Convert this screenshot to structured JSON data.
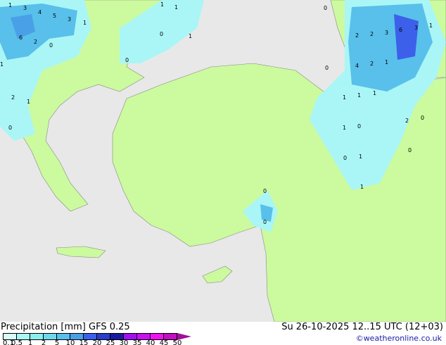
{
  "legend": {
    "title": "Precipitation [mm]  GFS 0.25",
    "datetime": "Su 26-10-2025 12..15 UTC (12+03)",
    "credit": "©weatheronline.co.uk",
    "ticks": [
      "0.1",
      "0.5",
      "1",
      "2",
      "5",
      "10",
      "15",
      "20",
      "25",
      "30",
      "35",
      "40",
      "45",
      "50"
    ],
    "colors": [
      "#d8fbfb",
      "#aaf6f6",
      "#8ceeee",
      "#6cdaea",
      "#58c0ea",
      "#4aa0e6",
      "#3c60ea",
      "#2a3ccc",
      "#1a1aa0",
      "#a010f0",
      "#c810f0",
      "#f010f0",
      "#c010c0"
    ]
  },
  "map": {
    "land_color": "#ccfa9e",
    "sea_color": "#e8e8e8",
    "values": [
      "1",
      "3",
      "4",
      "5",
      "3",
      "1",
      "6",
      "2",
      "0",
      "1",
      "0",
      "1",
      "1",
      "1",
      "0",
      "0",
      "2",
      "2",
      "3",
      "6",
      "3",
      "1",
      "0",
      "4",
      "2",
      "1",
      "1",
      "1",
      "1",
      "2",
      "1",
      "0",
      "1",
      "0",
      "2",
      "0",
      "0",
      "1",
      "0",
      "1",
      "0",
      "0"
    ]
  }
}
